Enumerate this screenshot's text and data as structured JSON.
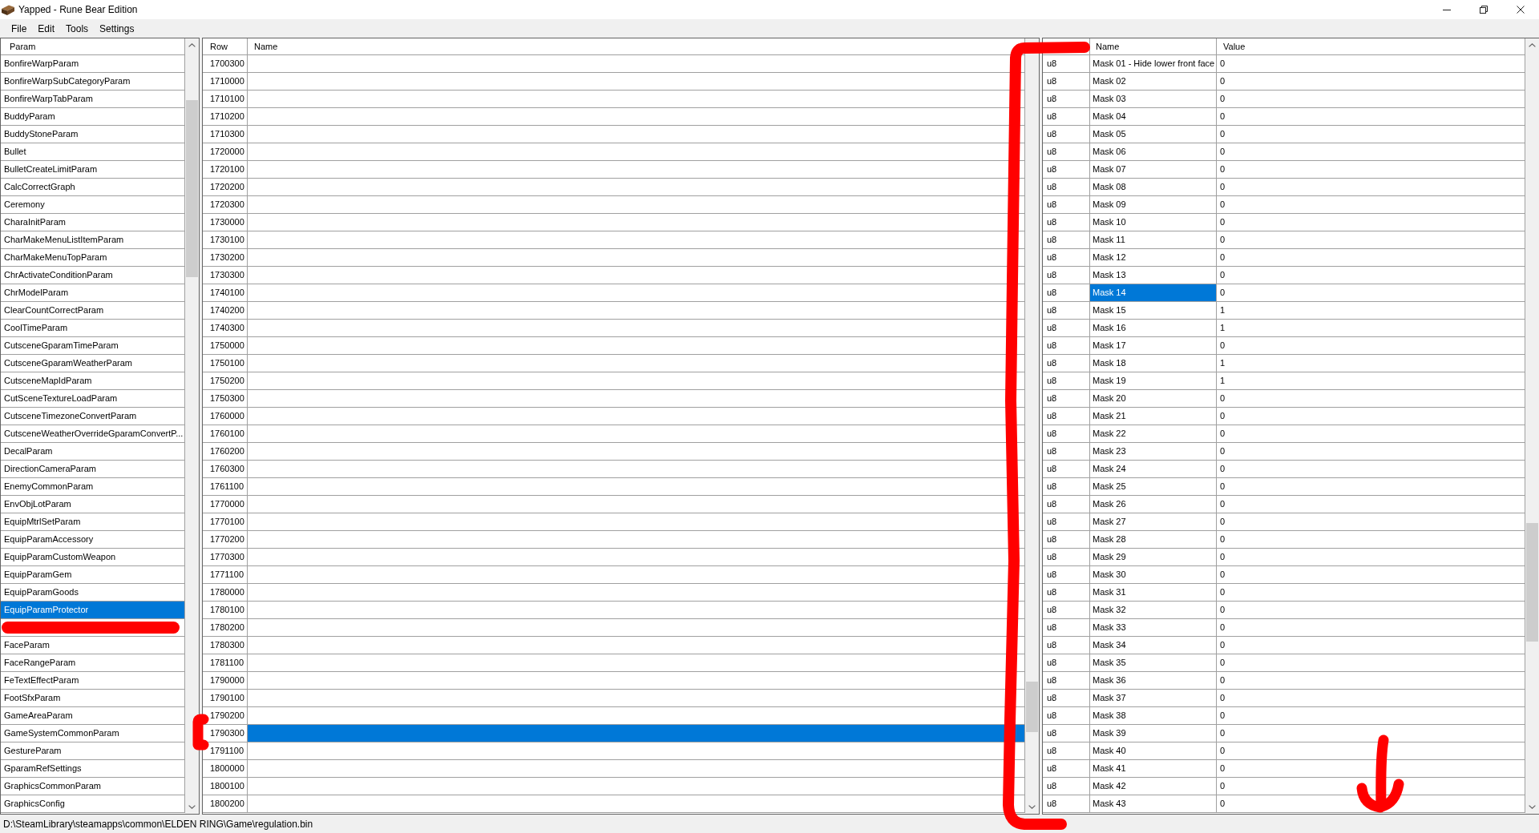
{
  "window": {
    "title": "Yapped - Rune Bear Edition"
  },
  "menu": [
    "File",
    "Edit",
    "Tools",
    "Settings"
  ],
  "params_panel": {
    "column": "Param",
    "items": [
      {
        "label": "BonfireWarpParam",
        "selected": false
      },
      {
        "label": "BonfireWarpSubCategoryParam",
        "selected": false
      },
      {
        "label": "BonfireWarpTabParam",
        "selected": false
      },
      {
        "label": "BuddyParam",
        "selected": false
      },
      {
        "label": "BuddyStoneParam",
        "selected": false
      },
      {
        "label": "Bullet",
        "selected": false
      },
      {
        "label": "BulletCreateLimitParam",
        "selected": false
      },
      {
        "label": "CalcCorrectGraph",
        "selected": false
      },
      {
        "label": "Ceremony",
        "selected": false
      },
      {
        "label": "CharaInitParam",
        "selected": false
      },
      {
        "label": "CharMakeMenuListItemParam",
        "selected": false
      },
      {
        "label": "CharMakeMenuTopParam",
        "selected": false
      },
      {
        "label": "ChrActivateConditionParam",
        "selected": false
      },
      {
        "label": "ChrModelParam",
        "selected": false
      },
      {
        "label": "ClearCountCorrectParam",
        "selected": false
      },
      {
        "label": "CoolTimeParam",
        "selected": false
      },
      {
        "label": "CutsceneGparamTimeParam",
        "selected": false
      },
      {
        "label": "CutsceneGparamWeatherParam",
        "selected": false
      },
      {
        "label": "CutsceneMapIdParam",
        "selected": false
      },
      {
        "label": "CutSceneTextureLoadParam",
        "selected": false
      },
      {
        "label": "CutsceneTimezoneConvertParam",
        "selected": false
      },
      {
        "label": "CutsceneWeatherOverrideGparamConvertP...",
        "selected": false
      },
      {
        "label": "DecalParam",
        "selected": false
      },
      {
        "label": "DirectionCameraParam",
        "selected": false
      },
      {
        "label": "EnemyCommonParam",
        "selected": false
      },
      {
        "label": "EnvObjLotParam",
        "selected": false
      },
      {
        "label": "EquipMtrlSetParam",
        "selected": false
      },
      {
        "label": "EquipParamAccessory",
        "selected": false
      },
      {
        "label": "EquipParamCustomWeapon",
        "selected": false
      },
      {
        "label": "EquipParamGem",
        "selected": false
      },
      {
        "label": "EquipParamGoods",
        "selected": false
      },
      {
        "label": "EquipParamProtector",
        "selected": true
      },
      {
        "selected": false
      },
      {
        "label": "FaceParam",
        "selected": false
      },
      {
        "label": "FaceRangeParam",
        "selected": false
      },
      {
        "label": "FeTextEffectParam",
        "selected": false
      },
      {
        "label": "FootSfxParam",
        "selected": false
      },
      {
        "label": "GameAreaParam",
        "selected": false
      },
      {
        "label": "GameSystemCommonParam",
        "selected": false
      },
      {
        "label": "GestureParam",
        "selected": false
      },
      {
        "label": "GparamRefSettings",
        "selected": false
      },
      {
        "label": "GraphicsCommonParam",
        "selected": false
      },
      {
        "label": "GraphicsConfig",
        "selected": false
      }
    ]
  },
  "rows_panel": {
    "columns": [
      "Row",
      "Name"
    ],
    "rows": [
      {
        "row": "1700300",
        "selected": false
      },
      {
        "row": "1710000",
        "selected": false
      },
      {
        "row": "1710100",
        "selected": false
      },
      {
        "row": "1710200",
        "selected": false
      },
      {
        "row": "1710300",
        "selected": false
      },
      {
        "row": "1720000",
        "selected": false
      },
      {
        "row": "1720100",
        "selected": false
      },
      {
        "row": "1720200",
        "selected": false
      },
      {
        "row": "1720300",
        "selected": false
      },
      {
        "row": "1730000",
        "selected": false
      },
      {
        "row": "1730100",
        "selected": false
      },
      {
        "row": "1730200",
        "selected": false
      },
      {
        "row": "1730300",
        "selected": false
      },
      {
        "row": "1740100",
        "selected": false
      },
      {
        "row": "1740200",
        "selected": false
      },
      {
        "row": "1740300",
        "selected": false
      },
      {
        "row": "1750000",
        "selected": false
      },
      {
        "row": "1750100",
        "selected": false
      },
      {
        "row": "1750200",
        "selected": false
      },
      {
        "row": "1750300",
        "selected": false
      },
      {
        "row": "1760000",
        "selected": false
      },
      {
        "row": "1760100",
        "selected": false
      },
      {
        "row": "1760200",
        "selected": false
      },
      {
        "row": "1760300",
        "selected": false
      },
      {
        "row": "1761100",
        "selected": false
      },
      {
        "row": "1770000",
        "selected": false
      },
      {
        "row": "1770100",
        "selected": false
      },
      {
        "row": "1770200",
        "selected": false
      },
      {
        "row": "1770300",
        "selected": false
      },
      {
        "row": "1771100",
        "selected": false
      },
      {
        "row": "1780000",
        "selected": false
      },
      {
        "row": "1780100",
        "selected": false
      },
      {
        "row": "1780200",
        "selected": false
      },
      {
        "row": "1780300",
        "selected": false
      },
      {
        "row": "1781100",
        "selected": false
      },
      {
        "row": "1790000",
        "selected": false
      },
      {
        "row": "1790100",
        "selected": false
      },
      {
        "row": "1790200",
        "selected": false
      },
      {
        "row": "1790300",
        "selected": true
      },
      {
        "row": "1791100",
        "selected": false
      },
      {
        "row": "1800000",
        "selected": false
      },
      {
        "row": "1800100",
        "selected": false
      },
      {
        "row": "1800200",
        "selected": false
      }
    ]
  },
  "fields_panel": {
    "columns": [
      "Name",
      "Value"
    ],
    "rows": [
      {
        "type": "u8",
        "name": "Mask 01 - Hide lower front face",
        "value": "0",
        "selected": false
      },
      {
        "type": "u8",
        "name": "Mask 02",
        "value": "0",
        "selected": false
      },
      {
        "type": "u8",
        "name": "Mask 03",
        "value": "0",
        "selected": false
      },
      {
        "type": "u8",
        "name": "Mask 04",
        "value": "0",
        "selected": false
      },
      {
        "type": "u8",
        "name": "Mask 05",
        "value": "0",
        "selected": false
      },
      {
        "type": "u8",
        "name": "Mask 06",
        "value": "0",
        "selected": false
      },
      {
        "type": "u8",
        "name": "Mask 07",
        "value": "0",
        "selected": false
      },
      {
        "type": "u8",
        "name": "Mask 08",
        "value": "0",
        "selected": false
      },
      {
        "type": "u8",
        "name": "Mask 09",
        "value": "0",
        "selected": false
      },
      {
        "type": "u8",
        "name": "Mask 10",
        "value": "0",
        "selected": false
      },
      {
        "type": "u8",
        "name": "Mask 11",
        "value": "0",
        "selected": false
      },
      {
        "type": "u8",
        "name": "Mask 12",
        "value": "0",
        "selected": false
      },
      {
        "type": "u8",
        "name": "Mask 13",
        "value": "0",
        "selected": false
      },
      {
        "type": "u8",
        "name": "Mask 14",
        "value": "0",
        "selected": true
      },
      {
        "type": "u8",
        "name": "Mask 15",
        "value": "1",
        "selected": false
      },
      {
        "type": "u8",
        "name": "Mask 16",
        "value": "1",
        "selected": false
      },
      {
        "type": "u8",
        "name": "Mask 17",
        "value": "0",
        "selected": false
      },
      {
        "type": "u8",
        "name": "Mask 18",
        "value": "1",
        "selected": false
      },
      {
        "type": "u8",
        "name": "Mask 19",
        "value": "1",
        "selected": false
      },
      {
        "type": "u8",
        "name": "Mask 20",
        "value": "0",
        "selected": false
      },
      {
        "type": "u8",
        "name": "Mask 21",
        "value": "0",
        "selected": false
      },
      {
        "type": "u8",
        "name": "Mask 22",
        "value": "0",
        "selected": false
      },
      {
        "type": "u8",
        "name": "Mask 23",
        "value": "0",
        "selected": false
      },
      {
        "type": "u8",
        "name": "Mask 24",
        "value": "0",
        "selected": false
      },
      {
        "type": "u8",
        "name": "Mask 25",
        "value": "0",
        "selected": false
      },
      {
        "type": "u8",
        "name": "Mask 26",
        "value": "0",
        "selected": false
      },
      {
        "type": "u8",
        "name": "Mask 27",
        "value": "0",
        "selected": false
      },
      {
        "type": "u8",
        "name": "Mask 28",
        "value": "0",
        "selected": false
      },
      {
        "type": "u8",
        "name": "Mask 29",
        "value": "0",
        "selected": false
      },
      {
        "type": "u8",
        "name": "Mask 30",
        "value": "0",
        "selected": false
      },
      {
        "type": "u8",
        "name": "Mask 31",
        "value": "0",
        "selected": false
      },
      {
        "type": "u8",
        "name": "Mask 32",
        "value": "0",
        "selected": false
      },
      {
        "type": "u8",
        "name": "Mask 33",
        "value": "0",
        "selected": false
      },
      {
        "type": "u8",
        "name": "Mask 34",
        "value": "0",
        "selected": false
      },
      {
        "type": "u8",
        "name": "Mask 35",
        "value": "0",
        "selected": false
      },
      {
        "type": "u8",
        "name": "Mask 36",
        "value": "0",
        "selected": false
      },
      {
        "type": "u8",
        "name": "Mask 37",
        "value": "0",
        "selected": false
      },
      {
        "type": "u8",
        "name": "Mask 38",
        "value": "0",
        "selected": false
      },
      {
        "type": "u8",
        "name": "Mask 39",
        "value": "0",
        "selected": false
      },
      {
        "type": "u8",
        "name": "Mask 40",
        "value": "0",
        "selected": false
      },
      {
        "type": "u8",
        "name": "Mask 41",
        "value": "0",
        "selected": false
      },
      {
        "type": "u8",
        "name": "Mask 42",
        "value": "0",
        "selected": false
      },
      {
        "type": "u8",
        "name": "Mask 43",
        "value": "0",
        "selected": false
      }
    ]
  },
  "status_bar": {
    "path": "D:\\SteamLibrary\\steamapps\\common\\ELDEN RING\\Game\\regulation.bin"
  }
}
